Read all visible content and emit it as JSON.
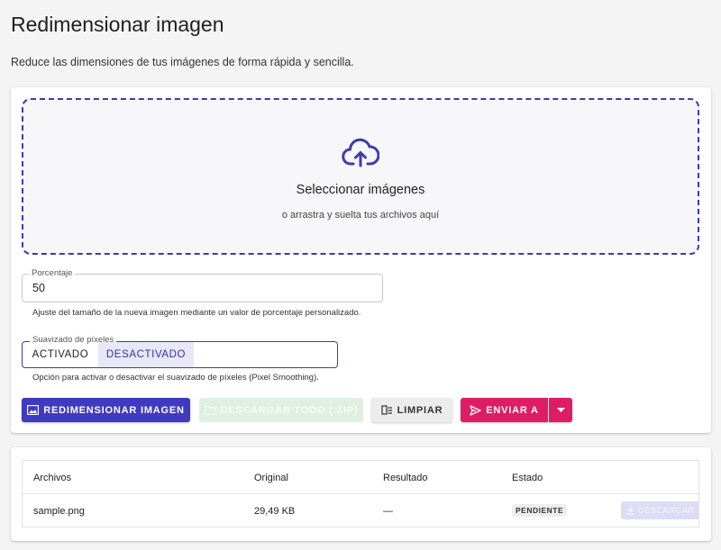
{
  "page": {
    "title": "Redimensionar imagen",
    "subtitle": "Reduce las dimensiones de tus imágenes de forma rápida y sencilla."
  },
  "dropzone": {
    "icon": "cloud-upload-icon",
    "title": "Seleccionar imágenes",
    "subtitle": "o arrastra y suelta tus archivos aquí"
  },
  "percentage": {
    "label": "Porcentaje",
    "value": "50",
    "helper": "Ajuste del tamaño de la nueva imagen mediante un valor de porcentaje personalizado."
  },
  "smoothing": {
    "label": "Suavizado de píxeles",
    "on_label": "ACTIVADO",
    "off_label": "DESACTIVADO",
    "selected": "DESACTIVADO",
    "helper": "Opción para activar o desactivar el suavizado de píxeles (Pixel Smoothing)."
  },
  "actions": {
    "resize_label": "REDIMENSIONAR IMAGEN",
    "download_all_label": "DESCARGAR TODO (.ZIP)",
    "clear_label": "LIMPIAR",
    "send_label": "ENVIAR A"
  },
  "table": {
    "headers": [
      "Archivos",
      "Original",
      "Resultado",
      "Estado"
    ],
    "rows": [
      {
        "file": "sample.png",
        "original": "29,49 KB",
        "result": "—",
        "status": "PENDIENTE",
        "download_label": "DESCARGAR"
      }
    ]
  },
  "colors": {
    "primary": "#3f3ac0",
    "accent": "#df1d67",
    "success_disabled": "#dff0e1",
    "background": "#f4f4f4"
  }
}
